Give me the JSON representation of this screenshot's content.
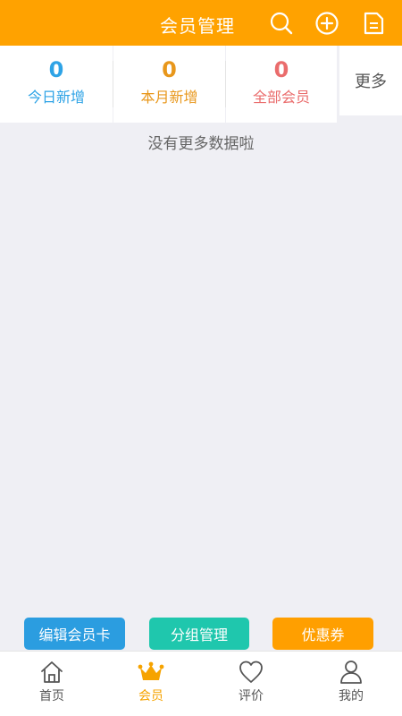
{
  "header": {
    "title": "会员管理",
    "icons": [
      "search-icon",
      "add-circle-icon",
      "document-icon"
    ]
  },
  "stats": [
    {
      "value": "0",
      "label": "今日新增",
      "color": "#2ea3e6"
    },
    {
      "value": "0",
      "label": "本月新增",
      "color": "#e8971b"
    },
    {
      "value": "0",
      "label": "全部会员",
      "color": "#ea6c6c"
    }
  ],
  "more_label": "更多",
  "empty_text": "没有更多数据啦",
  "actions": [
    {
      "label": "编辑会员卡",
      "color": "#2b9de0"
    },
    {
      "label": "分组管理",
      "color": "#1fc7ad"
    },
    {
      "label": "优惠券",
      "color": "#ff9f00"
    }
  ],
  "tabs": [
    {
      "label": "首页",
      "icon": "home-icon",
      "active": false
    },
    {
      "label": "会员",
      "icon": "crown-icon",
      "active": true
    },
    {
      "label": "评价",
      "icon": "heart-icon",
      "active": false
    },
    {
      "label": "我的",
      "icon": "person-icon",
      "active": false
    }
  ],
  "colors": {
    "header": "#ffa200",
    "accent": "#f6a300",
    "background": "#efeff4"
  }
}
